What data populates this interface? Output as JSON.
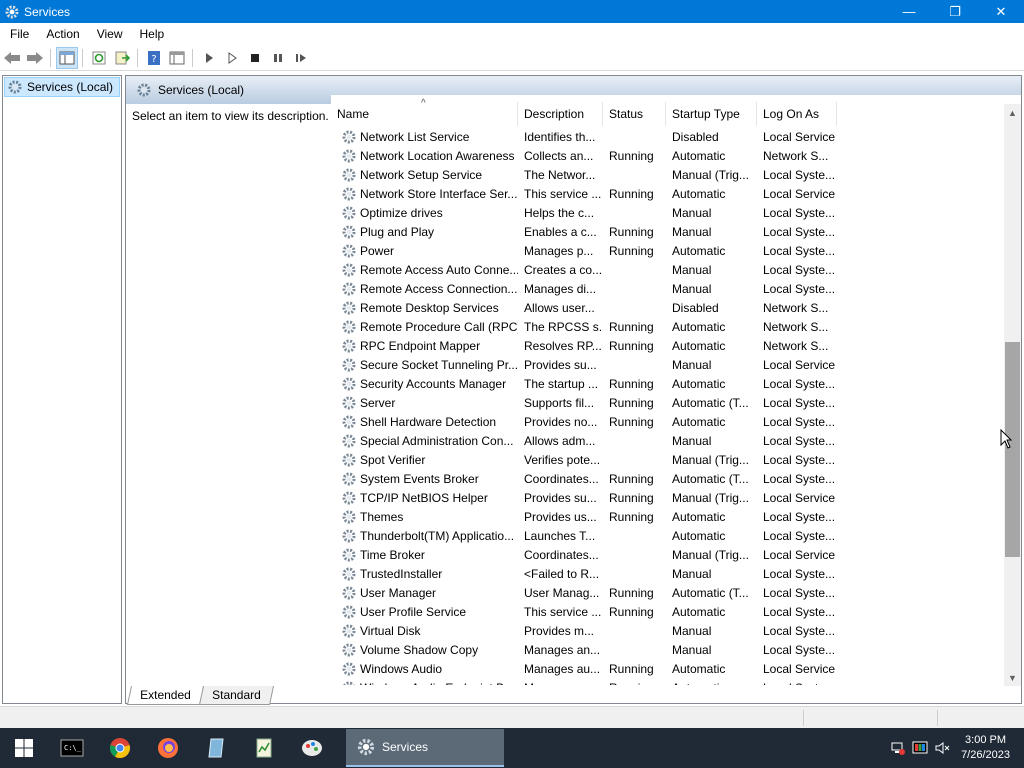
{
  "window": {
    "title": "Services",
    "minimize": "—",
    "maximize": "❐",
    "close": "✕"
  },
  "menu": [
    "File",
    "Action",
    "View",
    "Help"
  ],
  "tree": {
    "root_label": "Services (Local)"
  },
  "pane": {
    "header": "Services (Local)",
    "description_hint": "Select an item to view its description."
  },
  "columns": [
    "Name",
    "Description",
    "Status",
    "Startup Type",
    "Log On As"
  ],
  "services": [
    {
      "name": "Network List Service",
      "description": "Identifies th...",
      "status": "",
      "startup": "Disabled",
      "logon": "Local Service"
    },
    {
      "name": "Network Location Awareness",
      "description": "Collects an...",
      "status": "Running",
      "startup": "Automatic",
      "logon": "Network S..."
    },
    {
      "name": "Network Setup Service",
      "description": "The Networ...",
      "status": "",
      "startup": "Manual (Trig...",
      "logon": "Local Syste..."
    },
    {
      "name": "Network Store Interface Ser...",
      "description": "This service ...",
      "status": "Running",
      "startup": "Automatic",
      "logon": "Local Service"
    },
    {
      "name": "Optimize drives",
      "description": "Helps the c...",
      "status": "",
      "startup": "Manual",
      "logon": "Local Syste..."
    },
    {
      "name": "Plug and Play",
      "description": "Enables a c...",
      "status": "Running",
      "startup": "Manual",
      "logon": "Local Syste..."
    },
    {
      "name": "Power",
      "description": "Manages p...",
      "status": "Running",
      "startup": "Automatic",
      "logon": "Local Syste..."
    },
    {
      "name": "Remote Access Auto Conne...",
      "description": "Creates a co...",
      "status": "",
      "startup": "Manual",
      "logon": "Local Syste..."
    },
    {
      "name": "Remote Access Connection...",
      "description": "Manages di...",
      "status": "",
      "startup": "Manual",
      "logon": "Local Syste..."
    },
    {
      "name": "Remote Desktop Services",
      "description": "Allows user...",
      "status": "",
      "startup": "Disabled",
      "logon": "Network S..."
    },
    {
      "name": "Remote Procedure Call (RPC)",
      "description": "The RPCSS s...",
      "status": "Running",
      "startup": "Automatic",
      "logon": "Network S..."
    },
    {
      "name": "RPC Endpoint Mapper",
      "description": "Resolves RP...",
      "status": "Running",
      "startup": "Automatic",
      "logon": "Network S..."
    },
    {
      "name": "Secure Socket Tunneling Pr...",
      "description": "Provides su...",
      "status": "",
      "startup": "Manual",
      "logon": "Local Service"
    },
    {
      "name": "Security Accounts Manager",
      "description": "The startup ...",
      "status": "Running",
      "startup": "Automatic",
      "logon": "Local Syste..."
    },
    {
      "name": "Server",
      "description": "Supports fil...",
      "status": "Running",
      "startup": "Automatic (T...",
      "logon": "Local Syste..."
    },
    {
      "name": "Shell Hardware Detection",
      "description": "Provides no...",
      "status": "Running",
      "startup": "Automatic",
      "logon": "Local Syste..."
    },
    {
      "name": "Special Administration Con...",
      "description": "Allows adm...",
      "status": "",
      "startup": "Manual",
      "logon": "Local Syste..."
    },
    {
      "name": "Spot Verifier",
      "description": "Verifies pote...",
      "status": "",
      "startup": "Manual (Trig...",
      "logon": "Local Syste..."
    },
    {
      "name": "System Events Broker",
      "description": "Coordinates...",
      "status": "Running",
      "startup": "Automatic (T...",
      "logon": "Local Syste..."
    },
    {
      "name": "TCP/IP NetBIOS Helper",
      "description": "Provides su...",
      "status": "Running",
      "startup": "Manual (Trig...",
      "logon": "Local Service"
    },
    {
      "name": "Themes",
      "description": "Provides us...",
      "status": "Running",
      "startup": "Automatic",
      "logon": "Local Syste..."
    },
    {
      "name": "Thunderbolt(TM) Applicatio...",
      "description": "Launches T...",
      "status": "",
      "startup": "Automatic",
      "logon": "Local Syste..."
    },
    {
      "name": "Time Broker",
      "description": "Coordinates...",
      "status": "",
      "startup": "Manual (Trig...",
      "logon": "Local Service"
    },
    {
      "name": "TrustedInstaller",
      "description": "<Failed to R...",
      "status": "",
      "startup": "Manual",
      "logon": "Local Syste..."
    },
    {
      "name": "User Manager",
      "description": "User Manag...",
      "status": "Running",
      "startup": "Automatic (T...",
      "logon": "Local Syste..."
    },
    {
      "name": "User Profile Service",
      "description": "This service ...",
      "status": "Running",
      "startup": "Automatic",
      "logon": "Local Syste..."
    },
    {
      "name": "Virtual Disk",
      "description": "Provides m...",
      "status": "",
      "startup": "Manual",
      "logon": "Local Syste..."
    },
    {
      "name": "Volume Shadow Copy",
      "description": "Manages an...",
      "status": "",
      "startup": "Manual",
      "logon": "Local Syste..."
    },
    {
      "name": "Windows Audio",
      "description": "Manages au...",
      "status": "Running",
      "startup": "Automatic",
      "logon": "Local Service"
    },
    {
      "name": "Windows Audio Endpoint B...",
      "description": "Manages au...",
      "status": "Running",
      "startup": "Automatic",
      "logon": "Local Syste..."
    }
  ],
  "tabs": [
    "Extended",
    "Standard"
  ],
  "taskbar": {
    "active_task": "Services",
    "time": "3:00 PM",
    "date": "7/26/2023"
  },
  "colors": {
    "titlebar": "#0078d7",
    "taskbar": "#1f2a36",
    "selection": "#cce8ff"
  }
}
